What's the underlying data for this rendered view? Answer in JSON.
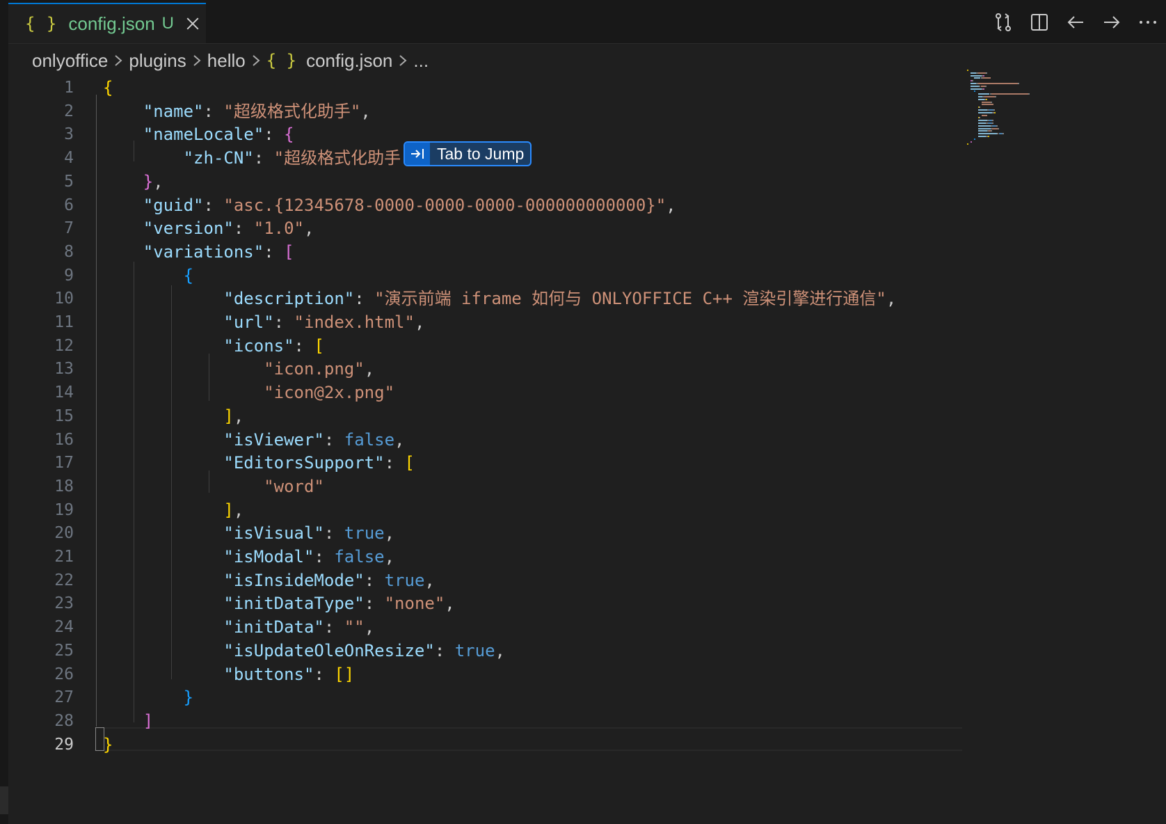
{
  "tab": {
    "icon": "{ }",
    "filename": "config.json",
    "status": "U",
    "icon_name": "json-icon"
  },
  "actions": [
    {
      "icon": "compare-changes-icon"
    },
    {
      "icon": "split-editor-icon"
    },
    {
      "icon": "arrow-left-icon"
    },
    {
      "icon": "arrow-right-icon"
    },
    {
      "icon": "more-actions-icon"
    }
  ],
  "breadcrumb": {
    "items": [
      "onlyoffice",
      "plugins",
      "hello",
      "config.json",
      "..."
    ],
    "file_icon": "{ }"
  },
  "hint": {
    "label": "Tab to Jump",
    "icon": "tab-jump-icon"
  },
  "editor": {
    "current_line": 29,
    "line_numbers": [
      "1",
      "2",
      "3",
      "4",
      "5",
      "6",
      "7",
      "8",
      "9",
      "10",
      "11",
      "12",
      "13",
      "14",
      "15",
      "16",
      "17",
      "18",
      "19",
      "20",
      "21",
      "22",
      "23",
      "24",
      "25",
      "26",
      "27",
      "28",
      "29"
    ],
    "lines": [
      [
        [
          "y",
          "{"
        ]
      ],
      [
        [
          "p",
          "    "
        ],
        [
          "k",
          "\"name\""
        ],
        [
          "p",
          ": "
        ],
        [
          "s",
          "\"超级格式化助手\""
        ],
        [
          "p",
          ","
        ]
      ],
      [
        [
          "p",
          "    "
        ],
        [
          "k",
          "\"nameLocale\""
        ],
        [
          "p",
          ": "
        ],
        [
          "m",
          "{"
        ]
      ],
      [
        [
          "p",
          "        "
        ],
        [
          "k",
          "\"zh-CN\""
        ],
        [
          "p",
          ": "
        ],
        [
          "s",
          "\"超级格式化助手\""
        ]
      ],
      [
        [
          "p",
          "    "
        ],
        [
          "m",
          "}"
        ],
        [
          "p",
          ","
        ]
      ],
      [
        [
          "p",
          "    "
        ],
        [
          "k",
          "\"guid\""
        ],
        [
          "p",
          ": "
        ],
        [
          "s",
          "\"asc.{12345678-0000-0000-0000-000000000000}\""
        ],
        [
          "p",
          ","
        ]
      ],
      [
        [
          "p",
          "    "
        ],
        [
          "k",
          "\"version\""
        ],
        [
          "p",
          ": "
        ],
        [
          "s",
          "\"1.0\""
        ],
        [
          "p",
          ","
        ]
      ],
      [
        [
          "p",
          "    "
        ],
        [
          "k",
          "\"variations\""
        ],
        [
          "p",
          ": "
        ],
        [
          "m",
          "["
        ]
      ],
      [
        [
          "p",
          "        "
        ],
        [
          "bl",
          "{"
        ]
      ],
      [
        [
          "p",
          "            "
        ],
        [
          "k",
          "\"description\""
        ],
        [
          "p",
          ": "
        ],
        [
          "s",
          "\"演示前端 iframe 如何与 ONLYOFFICE C++ 渲染引擎进行通信\""
        ],
        [
          "p",
          ","
        ]
      ],
      [
        [
          "p",
          "            "
        ],
        [
          "k",
          "\"url\""
        ],
        [
          "p",
          ": "
        ],
        [
          "s",
          "\"index.html\""
        ],
        [
          "p",
          ","
        ]
      ],
      [
        [
          "p",
          "            "
        ],
        [
          "k",
          "\"icons\""
        ],
        [
          "p",
          ": "
        ],
        [
          "y",
          "["
        ]
      ],
      [
        [
          "p",
          "                "
        ],
        [
          "s",
          "\"icon.png\""
        ],
        [
          "p",
          ","
        ]
      ],
      [
        [
          "p",
          "                "
        ],
        [
          "s",
          "\"icon@2x.png\""
        ]
      ],
      [
        [
          "p",
          "            "
        ],
        [
          "y",
          "]"
        ],
        [
          "p",
          ","
        ]
      ],
      [
        [
          "p",
          "            "
        ],
        [
          "k",
          "\"isViewer\""
        ],
        [
          "p",
          ": "
        ],
        [
          "b",
          "false"
        ],
        [
          "p",
          ","
        ]
      ],
      [
        [
          "p",
          "            "
        ],
        [
          "k",
          "\"EditorsSupport\""
        ],
        [
          "p",
          ": "
        ],
        [
          "y",
          "["
        ]
      ],
      [
        [
          "p",
          "                "
        ],
        [
          "s",
          "\"word\""
        ]
      ],
      [
        [
          "p",
          "            "
        ],
        [
          "y",
          "]"
        ],
        [
          "p",
          ","
        ]
      ],
      [
        [
          "p",
          "            "
        ],
        [
          "k",
          "\"isVisual\""
        ],
        [
          "p",
          ": "
        ],
        [
          "b",
          "true"
        ],
        [
          "p",
          ","
        ]
      ],
      [
        [
          "p",
          "            "
        ],
        [
          "k",
          "\"isModal\""
        ],
        [
          "p",
          ": "
        ],
        [
          "b",
          "false"
        ],
        [
          "p",
          ","
        ]
      ],
      [
        [
          "p",
          "            "
        ],
        [
          "k",
          "\"isInsideMode\""
        ],
        [
          "p",
          ": "
        ],
        [
          "b",
          "true"
        ],
        [
          "p",
          ","
        ]
      ],
      [
        [
          "p",
          "            "
        ],
        [
          "k",
          "\"initDataType\""
        ],
        [
          "p",
          ": "
        ],
        [
          "s",
          "\"none\""
        ],
        [
          "p",
          ","
        ]
      ],
      [
        [
          "p",
          "            "
        ],
        [
          "k",
          "\"initData\""
        ],
        [
          "p",
          ": "
        ],
        [
          "s",
          "\"\""
        ],
        [
          "p",
          ","
        ]
      ],
      [
        [
          "p",
          "            "
        ],
        [
          "k",
          "\"isUpdateOleOnResize\""
        ],
        [
          "p",
          ": "
        ],
        [
          "b",
          "true"
        ],
        [
          "p",
          ","
        ]
      ],
      [
        [
          "p",
          "            "
        ],
        [
          "k",
          "\"buttons\""
        ],
        [
          "p",
          ": "
        ],
        [
          "y",
          "[]"
        ]
      ],
      [
        [
          "p",
          "        "
        ],
        [
          "bl",
          "}"
        ]
      ],
      [
        [
          "p",
          "    "
        ],
        [
          "m",
          "]"
        ]
      ],
      [
        [
          "y",
          "}"
        ]
      ]
    ]
  }
}
